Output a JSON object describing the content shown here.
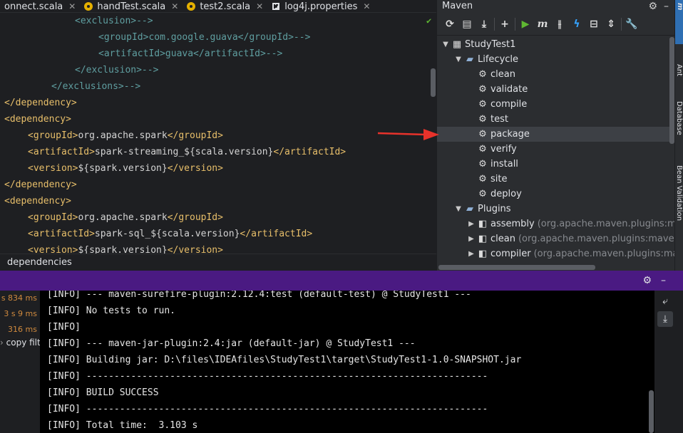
{
  "tabs": [
    {
      "label": "onnect.scala"
    },
    {
      "label": "handTest.scala"
    },
    {
      "label": "test2.scala"
    },
    {
      "label": "log4j.properties"
    }
  ],
  "close_glyph": "✕",
  "editor": {
    "lines": [
      {
        "indent": 6,
        "parts": [
          {
            "c": "cmt",
            "t": "<exclusion>-->"
          }
        ]
      },
      {
        "indent": 8,
        "parts": [
          {
            "c": "cmt",
            "t": "<groupId>com.google.guava</groupId>-->"
          }
        ]
      },
      {
        "indent": 8,
        "parts": [
          {
            "c": "cmt",
            "t": "<artifactId>guava</artifactId>-->"
          }
        ]
      },
      {
        "indent": 6,
        "parts": [
          {
            "c": "cmt",
            "t": "</exclusion>-->"
          }
        ]
      },
      {
        "indent": 4,
        "parts": [
          {
            "c": "cmt",
            "t": "</exclusions>-->"
          }
        ]
      },
      {
        "indent": 0,
        "parts": [
          {
            "c": "tag",
            "t": "</dependency>"
          }
        ]
      },
      {
        "indent": 0,
        "parts": [
          {
            "c": "tag",
            "t": "<dependency>"
          }
        ]
      },
      {
        "indent": 2,
        "parts": [
          {
            "c": "tag",
            "t": "<groupId>"
          },
          {
            "c": "txt",
            "t": "org.apache.spark"
          },
          {
            "c": "tag",
            "t": "</groupId>"
          }
        ]
      },
      {
        "indent": 2,
        "parts": [
          {
            "c": "tag",
            "t": "<artifactId>"
          },
          {
            "c": "txt",
            "t": "spark-streaming_${scala.version}"
          },
          {
            "c": "tag",
            "t": "</artifactId>"
          }
        ]
      },
      {
        "indent": 2,
        "parts": [
          {
            "c": "tag",
            "t": "<version>"
          },
          {
            "c": "txt",
            "t": "${spark.version}"
          },
          {
            "c": "tag",
            "t": "</version>"
          }
        ]
      },
      {
        "indent": 0,
        "parts": [
          {
            "c": "tag",
            "t": "</dependency>"
          }
        ]
      },
      {
        "indent": 0,
        "parts": [
          {
            "c": "tag",
            "t": "<dependency>"
          }
        ]
      },
      {
        "indent": 2,
        "parts": [
          {
            "c": "tag",
            "t": "<groupId>"
          },
          {
            "c": "txt",
            "t": "org.apache.spark"
          },
          {
            "c": "tag",
            "t": "</groupId>"
          }
        ]
      },
      {
        "indent": 2,
        "parts": [
          {
            "c": "tag",
            "t": "<artifactId>"
          },
          {
            "c": "txt",
            "t": "spark-sql_${scala.version}"
          },
          {
            "c": "tag",
            "t": "</artifactId>"
          }
        ]
      },
      {
        "indent": 2,
        "parts": [
          {
            "c": "tag",
            "t": "<version>"
          },
          {
            "c": "txt",
            "t": "${spark.version}"
          },
          {
            "c": "tag",
            "t": "</version>"
          }
        ]
      }
    ]
  },
  "breadcrumb": "dependencies",
  "maven": {
    "title": "Maven",
    "tree": [
      {
        "level": 0,
        "arrow": "▼",
        "icon": "maven-project-icon",
        "glyph": "▦",
        "label": "StudyTest1",
        "hint": ""
      },
      {
        "level": 1,
        "arrow": "▼",
        "icon": "folder-icon",
        "glyph": "▰",
        "label": "Lifecycle",
        "hint": ""
      },
      {
        "level": 2,
        "arrow": "",
        "icon": "gear-icon",
        "glyph": "⚙",
        "label": "clean",
        "hint": ""
      },
      {
        "level": 2,
        "arrow": "",
        "icon": "gear-icon",
        "glyph": "⚙",
        "label": "validate",
        "hint": ""
      },
      {
        "level": 2,
        "arrow": "",
        "icon": "gear-icon",
        "glyph": "⚙",
        "label": "compile",
        "hint": ""
      },
      {
        "level": 2,
        "arrow": "",
        "icon": "gear-icon",
        "glyph": "⚙",
        "label": "test",
        "hint": ""
      },
      {
        "level": 2,
        "arrow": "",
        "icon": "gear-icon",
        "glyph": "⚙",
        "label": "package",
        "hint": ""
      },
      {
        "level": 2,
        "arrow": "",
        "icon": "gear-icon",
        "glyph": "⚙",
        "label": "verify",
        "hint": ""
      },
      {
        "level": 2,
        "arrow": "",
        "icon": "gear-icon",
        "glyph": "⚙",
        "label": "install",
        "hint": ""
      },
      {
        "level": 2,
        "arrow": "",
        "icon": "gear-icon",
        "glyph": "⚙",
        "label": "site",
        "hint": ""
      },
      {
        "level": 2,
        "arrow": "",
        "icon": "gear-icon",
        "glyph": "⚙",
        "label": "deploy",
        "hint": ""
      },
      {
        "level": 1,
        "arrow": "▼",
        "icon": "folder-icon",
        "glyph": "▰",
        "label": "Plugins",
        "hint": ""
      },
      {
        "level": 2,
        "arrow": "▶",
        "icon": "plugin-icon",
        "glyph": "◧",
        "label": "assembly",
        "hint": "(org.apache.maven.plugins:maven-"
      },
      {
        "level": 2,
        "arrow": "▶",
        "icon": "plugin-icon",
        "glyph": "◧",
        "label": "clean",
        "hint": "(org.apache.maven.plugins:maven-clea"
      },
      {
        "level": 2,
        "arrow": "▶",
        "icon": "plugin-icon",
        "glyph": "◧",
        "label": "compiler",
        "hint": "(org.apache.maven.plugins:maven-c"
      }
    ]
  },
  "right_strip": [
    {
      "label": "m",
      "name": "maven-tab"
    },
    {
      "label": "Ant",
      "name": "ant-tab"
    },
    {
      "label": "Database",
      "name": "database-tab"
    },
    {
      "label": "Bean Validation",
      "name": "bean-validation-tab"
    }
  ],
  "run": {
    "timings": [
      "s 834 ms",
      "3 s 9 ms",
      "316 ms"
    ],
    "copy_item": "copy filt",
    "console_lines": [
      "[INFO] --- maven-surefire-plugin:2.12.4:test (default-test) @ StudyTest1 ---",
      "[INFO] No tests to run.",
      "[INFO]",
      "[INFO] --- maven-jar-plugin:2.4:jar (default-jar) @ StudyTest1 ---",
      "[INFO] Building jar: D:\\files\\IDEAfiles\\StudyTest1\\target\\StudyTest1-1.0-SNAPSHOT.jar",
      "[INFO] ------------------------------------------------------------------------",
      "[INFO] BUILD SUCCESS",
      "[INFO] ------------------------------------------------------------------------",
      "[INFO] Total time:  3.103 s"
    ]
  },
  "colors": {
    "run_header": "#4a1a82",
    "arrow": "#e8322b",
    "tag": "#e8bf6a",
    "comment": "#5f9ea0"
  }
}
